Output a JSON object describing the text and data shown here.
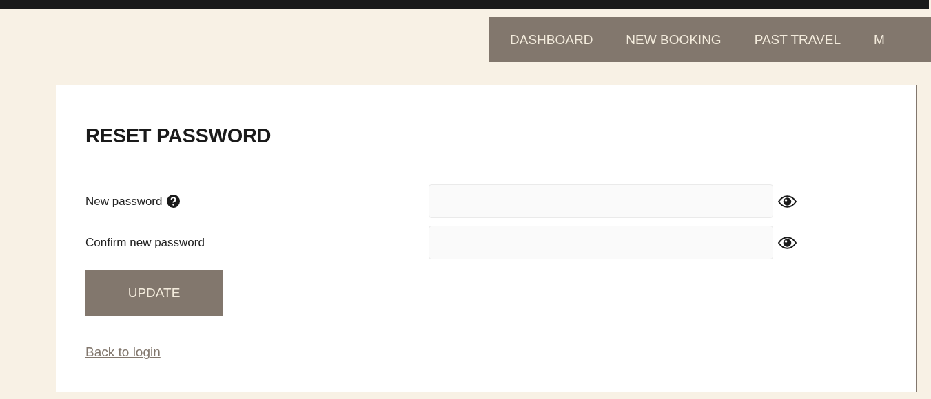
{
  "nav": {
    "items": [
      {
        "label": "DASHBOARD"
      },
      {
        "label": "NEW BOOKING"
      },
      {
        "label": "PAST TRAVEL"
      },
      {
        "label": "M"
      }
    ]
  },
  "card": {
    "title": "RESET PASSWORD",
    "fields": [
      {
        "label": "New password",
        "help": true
      },
      {
        "label": "Confirm new password",
        "help": false
      }
    ],
    "button": "UPDATE",
    "link": "Back to login"
  }
}
